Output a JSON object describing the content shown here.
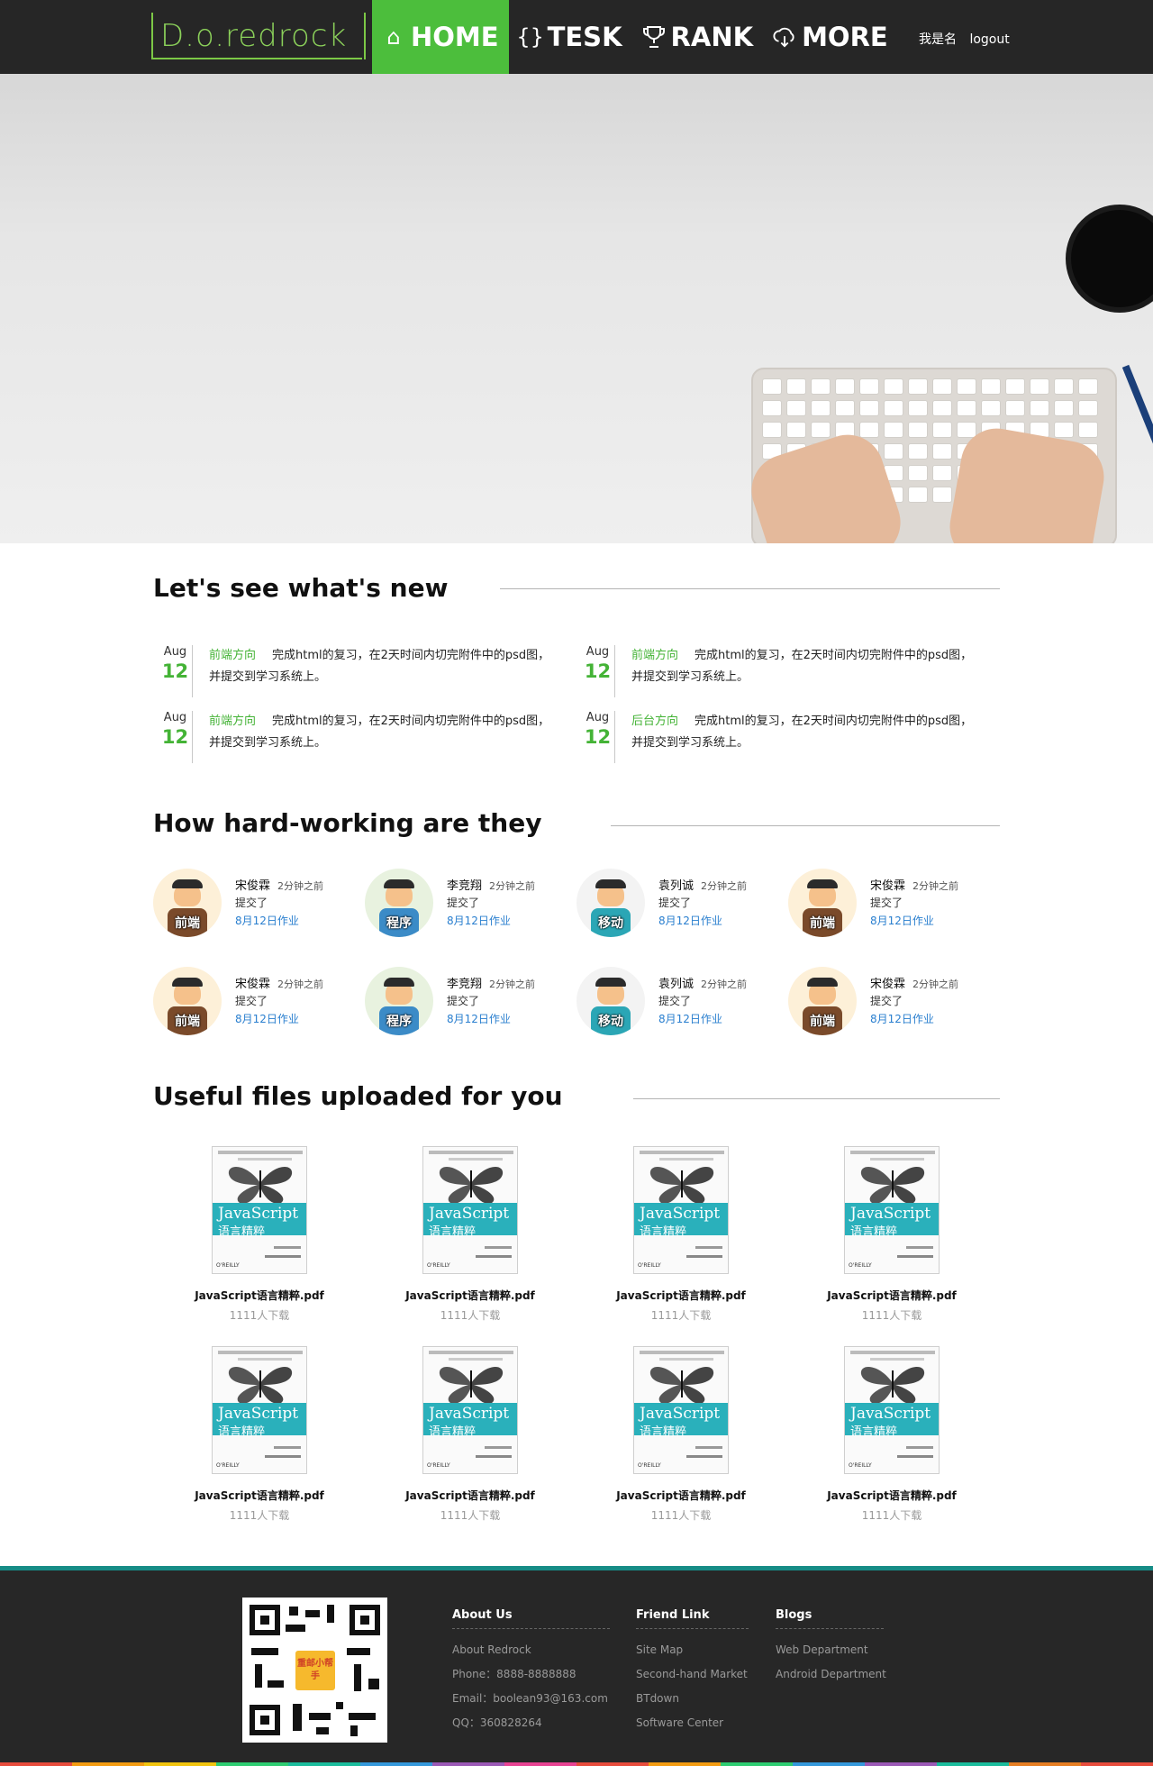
{
  "header": {
    "logo_text": "D.o.redrock",
    "nav": [
      {
        "label": "HOME",
        "icon": "home-icon",
        "glyph": "⌂",
        "active": true
      },
      {
        "label": "TESK",
        "icon": "braces-icon",
        "glyph": "{}",
        "active": false
      },
      {
        "label": "RANK",
        "icon": "trophy-icon",
        "glyph": "🏆",
        "active": false
      },
      {
        "label": "MORE",
        "icon": "cloud-download-icon",
        "glyph": "☁",
        "active": false
      }
    ],
    "username": "我是名",
    "logout": "logout",
    "active_color": "#4cbe3c"
  },
  "banner": {
    "slides": 4,
    "active_slide": 1
  },
  "news": {
    "title": "Let's see what's new",
    "items": [
      {
        "month": "Aug",
        "day": "12",
        "tag": "前端方向",
        "text": "完成html的复习，在2天时间内切完附件中的psd图，并提交到学习系统上。"
      },
      {
        "month": "Aug",
        "day": "12",
        "tag": "前端方向",
        "text": "完成html的复习，在2天时间内切完附件中的psd图，并提交到学习系统上。"
      },
      {
        "month": "Aug",
        "day": "12",
        "tag": "前端方向",
        "text": "完成html的复习，在2天时间内切完附件中的psd图，并提交到学习系统上。"
      },
      {
        "month": "Aug",
        "day": "12",
        "tag": "后台方向",
        "text": "完成html的复习，在2天时间内切完附件中的psd图，并提交到学习系统上。"
      }
    ]
  },
  "members": {
    "title": "How hard-working are they",
    "items": [
      {
        "name": "宋俊霖",
        "time": "2分钟之前",
        "action": "提交了",
        "homework": "8月12日作业",
        "badge": "前端",
        "body_color": "#7a4a2a",
        "bg": "#fdf0d8"
      },
      {
        "name": "李竞翔",
        "time": "2分钟之前",
        "action": "提交了",
        "homework": "8月12日作业",
        "badge": "程序",
        "body_color": "#3b8bc7",
        "bg": "#e8f2df"
      },
      {
        "name": "袁列诚",
        "time": "2分钟之前",
        "action": "提交了",
        "homework": "8月12日作业",
        "badge": "移动",
        "body_color": "#2ba6b5",
        "bg": "#f3f3f3"
      },
      {
        "name": "宋俊霖",
        "time": "2分钟之前",
        "action": "提交了",
        "homework": "8月12日作业",
        "badge": "前端",
        "body_color": "#7a4a2a",
        "bg": "#fdf0d8"
      },
      {
        "name": "宋俊霖",
        "time": "2分钟之前",
        "action": "提交了",
        "homework": "8月12日作业",
        "badge": "前端",
        "body_color": "#7a4a2a",
        "bg": "#fdf0d8"
      },
      {
        "name": "李竞翔",
        "time": "2分钟之前",
        "action": "提交了",
        "homework": "8月12日作业",
        "badge": "程序",
        "body_color": "#3b8bc7",
        "bg": "#e8f2df"
      },
      {
        "name": "袁列诚",
        "time": "2分钟之前",
        "action": "提交了",
        "homework": "8月12日作业",
        "badge": "移动",
        "body_color": "#2ba6b5",
        "bg": "#f3f3f3"
      },
      {
        "name": "宋俊霖",
        "time": "2分钟之前",
        "action": "提交了",
        "homework": "8月12日作业",
        "badge": "前端",
        "body_color": "#7a4a2a",
        "bg": "#fdf0d8"
      }
    ]
  },
  "files": {
    "title": "Useful files uploaded for you",
    "book_title": "JavaScript",
    "book_subtitle": "语言精粹",
    "book_publisher": "O'REILLY",
    "items": [
      {
        "name": "JavaScript语言精粹.pdf",
        "downloads": "1111人下载"
      },
      {
        "name": "JavaScript语言精粹.pdf",
        "downloads": "1111人下载"
      },
      {
        "name": "JavaScript语言精粹.pdf",
        "downloads": "1111人下载"
      },
      {
        "name": "JavaScript语言精粹.pdf",
        "downloads": "1111人下载"
      },
      {
        "name": "JavaScript语言精粹.pdf",
        "downloads": "1111人下载"
      },
      {
        "name": "JavaScript语言精粹.pdf",
        "downloads": "1111人下载"
      },
      {
        "name": "JavaScript语言精粹.pdf",
        "downloads": "1111人下载"
      },
      {
        "name": "JavaScript语言精粹.pdf",
        "downloads": "1111人下载"
      }
    ]
  },
  "footer": {
    "qr_logo": "重邮小帮手",
    "columns": [
      {
        "title": "About Us",
        "links": [
          "About Redrock",
          "Phone：8888-8888888",
          "Email：boolean93@163.com",
          "QQ：360828264"
        ]
      },
      {
        "title": "Friend Link",
        "links": [
          "Site Map",
          "Second-hand Market",
          "BTdown",
          "Software Center"
        ]
      },
      {
        "title": "Blogs",
        "links": [
          "Web Department",
          "Android Department"
        ]
      }
    ],
    "accent": "#168c86",
    "stripe_colors": [
      "#e74c3c",
      "#f39c12",
      "#f1c40f",
      "#2ecc71",
      "#1abc9c",
      "#3498db",
      "#9b59b6",
      "#e84393",
      "#e74c3c",
      "#f39c12",
      "#2ecc71",
      "#3498db",
      "#9b59b6",
      "#1abc9c",
      "#e67e22",
      "#e74c3c"
    ]
  }
}
